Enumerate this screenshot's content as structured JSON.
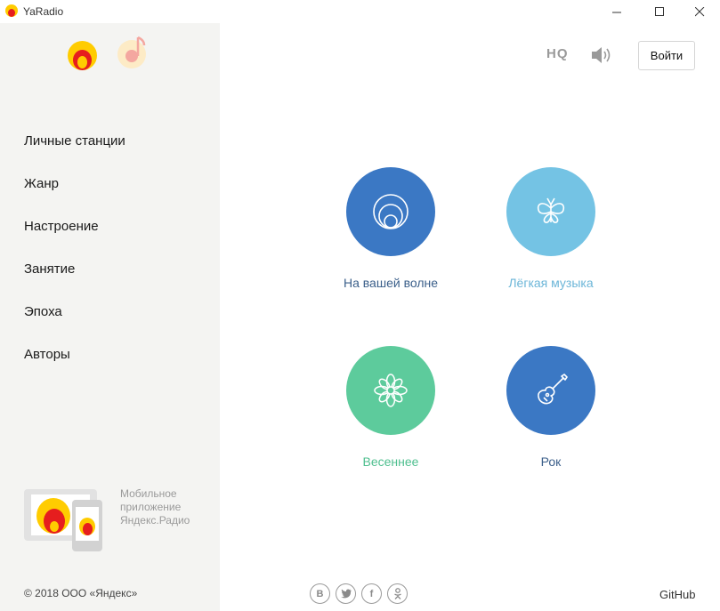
{
  "window": {
    "title": "YaRadio",
    "controls": {
      "minimize": "—",
      "maximize": "☐",
      "close": "✕"
    }
  },
  "sidebar": {
    "nav": [
      {
        "label": "Личные станции"
      },
      {
        "label": "Жанр"
      },
      {
        "label": "Настроение"
      },
      {
        "label": "Занятие"
      },
      {
        "label": "Эпоха"
      },
      {
        "label": "Авторы"
      }
    ],
    "promo": {
      "line1": "Мобильное",
      "line2": "приложение",
      "line3": "Яндекс.Радио"
    },
    "copyright": "© 2018 ООО «Яндекс»"
  },
  "header": {
    "hq": "HQ",
    "login": "Войти"
  },
  "stations": [
    {
      "label": "На вашей волне",
      "color": "#3b78c4",
      "label_color": "#3b5f8a",
      "icon": "wave-icon"
    },
    {
      "label": "Лёгкая музыка",
      "color": "#74c3e4",
      "label_color": "#6cb6d8",
      "icon": "butterfly-icon"
    },
    {
      "label": "Весеннее",
      "color": "#5dcb9c",
      "label_color": "#4fbf8f",
      "icon": "flower-icon"
    },
    {
      "label": "Рок",
      "color": "#3b78c4",
      "label_color": "#3b5f8a",
      "icon": "guitar-icon"
    }
  ],
  "footer": {
    "socials": [
      {
        "glyph": "В",
        "icon": "vk-icon"
      },
      {
        "glyph": "t",
        "icon": "twitter-icon"
      },
      {
        "glyph": "f",
        "icon": "facebook-icon"
      },
      {
        "glyph": "ok",
        "icon": "odnoklassniki-icon"
      }
    ],
    "github": "GitHub"
  },
  "colors": {
    "accent_blue": "#3b78c4",
    "accent_light_blue": "#74c3e4",
    "accent_green": "#5dcb9c",
    "logo_yellow": "#ffcc00",
    "logo_red": "#e61e1e",
    "sidebar_bg": "#f4f4f2"
  }
}
